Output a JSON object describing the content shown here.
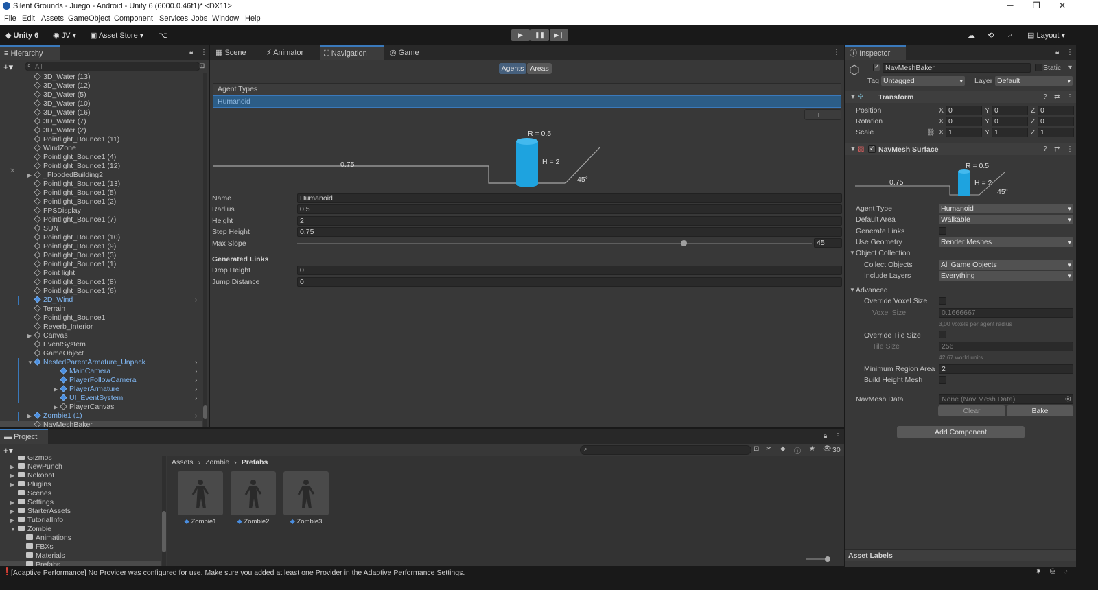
{
  "window": {
    "title": "Silent Grounds - Juego - Android - Unity 6 (6000.0.46f1)* <DX11>"
  },
  "menu": [
    "File",
    "Edit",
    "Assets",
    "GameObject",
    "Component",
    "Services",
    "Jobs",
    "Window",
    "Help"
  ],
  "toolbar": {
    "unity": "Unity 6",
    "account": "JV",
    "asset_store": "Asset Store",
    "layout": "Layout"
  },
  "hierarchy": {
    "tab": "Hierarchy",
    "search_placeholder": "All",
    "items": [
      {
        "label": "3D_Water (13)",
        "indent": 1
      },
      {
        "label": "3D_Water (12)",
        "indent": 1
      },
      {
        "label": "3D_Water (5)",
        "indent": 1
      },
      {
        "label": "3D_Water (10)",
        "indent": 1
      },
      {
        "label": "3D_Water (16)",
        "indent": 1
      },
      {
        "label": "3D_Water (7)",
        "indent": 1
      },
      {
        "label": "3D_Water (2)",
        "indent": 1
      },
      {
        "label": "Pointlight_Bounce1 (11)",
        "indent": 1
      },
      {
        "label": "WindZone",
        "indent": 1
      },
      {
        "label": "Pointlight_Bounce1 (4)",
        "indent": 1
      },
      {
        "label": "Pointlight_Bounce1 (12)",
        "indent": 1
      },
      {
        "label": "_FloodedBuilding2",
        "indent": 1,
        "fold": "▶"
      },
      {
        "label": "Pointlight_Bounce1 (13)",
        "indent": 1
      },
      {
        "label": "Pointlight_Bounce1 (5)",
        "indent": 1
      },
      {
        "label": "Pointlight_Bounce1 (2)",
        "indent": 1
      },
      {
        "label": "FPSDisplay",
        "indent": 1
      },
      {
        "label": "Pointlight_Bounce1 (7)",
        "indent": 1
      },
      {
        "label": "SUN",
        "indent": 1
      },
      {
        "label": "Pointlight_Bounce1 (10)",
        "indent": 1
      },
      {
        "label": "Pointlight_Bounce1 (9)",
        "indent": 1
      },
      {
        "label": "Pointlight_Bounce1 (3)",
        "indent": 1
      },
      {
        "label": "Pointlight_Bounce1 (1)",
        "indent": 1
      },
      {
        "label": "Point light",
        "indent": 1
      },
      {
        "label": "Pointlight_Bounce1 (8)",
        "indent": 1
      },
      {
        "label": "Pointlight_Bounce1 (6)",
        "indent": 1
      },
      {
        "label": "2D_Wind",
        "indent": 1,
        "blue": true,
        "more": true
      },
      {
        "label": "Terrain",
        "indent": 1
      },
      {
        "label": "Pointlight_Bounce1",
        "indent": 1
      },
      {
        "label": "Reverb_Interior",
        "indent": 1
      },
      {
        "label": "Canvas",
        "indent": 1,
        "fold": "▶"
      },
      {
        "label": "EventSystem",
        "indent": 1
      },
      {
        "label": "GameObject",
        "indent": 1
      },
      {
        "label": "NestedParentArmature_Unpack",
        "indent": 1,
        "blue": true,
        "fold": "▼",
        "more": true
      },
      {
        "label": "MainCamera",
        "indent": 2,
        "blue": true,
        "more": true
      },
      {
        "label": "PlayerFollowCamera",
        "indent": 2,
        "blue": true,
        "more": true
      },
      {
        "label": "PlayerArmature",
        "indent": 2,
        "blue": true,
        "fold": "▶",
        "more": true
      },
      {
        "label": "UI_EventSystem",
        "indent": 2,
        "blue": true,
        "more": true
      },
      {
        "label": "PlayerCanvas",
        "indent": 2,
        "fold": "▶"
      },
      {
        "label": "Zombie1 (1)",
        "indent": 1,
        "blue": true,
        "fold": "▶",
        "more": true
      },
      {
        "label": "NavMeshBaker",
        "indent": 1,
        "selected": true
      }
    ]
  },
  "center_tabs": [
    "Scene",
    "Animator",
    "Navigation",
    "Game"
  ],
  "navigation": {
    "agents_btn": "Agents",
    "areas_btn": "Areas",
    "agent_types_label": "Agent Types",
    "selected_agent": "Humanoid",
    "diagram": {
      "r": "R = 0.5",
      "h": "H = 2",
      "step": "0.75",
      "slope": "45°"
    },
    "fields": [
      {
        "label": "Name",
        "value": "Humanoid"
      },
      {
        "label": "Radius",
        "value": "0.5"
      },
      {
        "label": "Height",
        "value": "2"
      },
      {
        "label": "Step Height",
        "value": "0.75"
      }
    ],
    "max_slope": {
      "label": "Max Slope",
      "value": "45",
      "fraction": 0.75
    },
    "generated_links": "Generated Links",
    "links": [
      {
        "label": "Drop Height",
        "value": "0"
      },
      {
        "label": "Jump Distance",
        "value": "0"
      }
    ]
  },
  "inspector": {
    "tab": "Inspector",
    "object_name": "NavMeshBaker",
    "static": "Static",
    "tag_label": "Tag",
    "tag": "Untagged",
    "layer_label": "Layer",
    "layer": "Default",
    "transform": {
      "title": "Transform",
      "rows": [
        {
          "label": "Position",
          "x": "0",
          "y": "0",
          "z": "0"
        },
        {
          "label": "Rotation",
          "x": "0",
          "y": "0",
          "z": "0"
        },
        {
          "label": "Scale",
          "x": "1",
          "y": "1",
          "z": "1"
        }
      ]
    },
    "navmesh": {
      "title": "NavMesh Surface",
      "diagram": {
        "r": "R = 0.5",
        "h": "H = 2",
        "step": "0.75",
        "slope": "45°"
      },
      "agent_type_label": "Agent Type",
      "agent_type": "Humanoid",
      "default_area_label": "Default Area",
      "default_area": "Walkable",
      "generate_links_label": "Generate Links",
      "use_geometry_label": "Use Geometry",
      "use_geometry": "Render Meshes",
      "object_collection": "Object Collection",
      "collect_objects_label": "Collect Objects",
      "collect_objects": "All Game Objects",
      "include_layers_label": "Include Layers",
      "include_layers": "Everything",
      "advanced": "Advanced",
      "override_voxel_label": "Override Voxel Size",
      "voxel_size_label": "Voxel Size",
      "voxel_size": "0.1666667",
      "voxel_hint": "3,00 voxels per agent radius",
      "override_tile_label": "Override Tile Size",
      "tile_size_label": "Tile Size",
      "tile_size": "256",
      "tile_hint": "42,67 world units",
      "min_region_label": "Minimum Region Area",
      "min_region": "2",
      "build_height_label": "Build Height Mesh",
      "navmesh_data_label": "NavMesh Data",
      "navmesh_data": "None (Nav Mesh Data)",
      "clear": "Clear",
      "bake": "Bake"
    },
    "add_component": "Add Component",
    "asset_labels": "Asset Labels"
  },
  "project": {
    "tab": "Project",
    "count": "30",
    "breadcrumb": [
      "Assets",
      "Zombie",
      "Prefabs"
    ],
    "folders": [
      {
        "label": "Gizmos",
        "indent": 1
      },
      {
        "label": "NewPunch",
        "indent": 1,
        "fold": "▶"
      },
      {
        "label": "Nokobot",
        "indent": 1,
        "fold": "▶"
      },
      {
        "label": "Plugins",
        "indent": 1,
        "fold": "▶"
      },
      {
        "label": "Scenes",
        "indent": 1
      },
      {
        "label": "Settings",
        "indent": 1,
        "fold": "▶"
      },
      {
        "label": "StarterAssets",
        "indent": 1,
        "fold": "▶"
      },
      {
        "label": "TutorialInfo",
        "indent": 1,
        "fold": "▶"
      },
      {
        "label": "Zombie",
        "indent": 1,
        "fold": "▼"
      },
      {
        "label": "Animations",
        "indent": 2
      },
      {
        "label": "FBXs",
        "indent": 2
      },
      {
        "label": "Materials",
        "indent": 2
      },
      {
        "label": "Prefabs",
        "indent": 2,
        "selected": true
      }
    ],
    "assets": [
      "Zombie1",
      "Zombie2",
      "Zombie3"
    ]
  },
  "status": {
    "message": "[Adaptive Performance] No Provider was configured for use. Make sure you added at least one Provider in the Adaptive Performance Settings."
  },
  "colors": {
    "accent": "#3a79bb",
    "selection": "#2c5d87",
    "panel": "#383838"
  }
}
